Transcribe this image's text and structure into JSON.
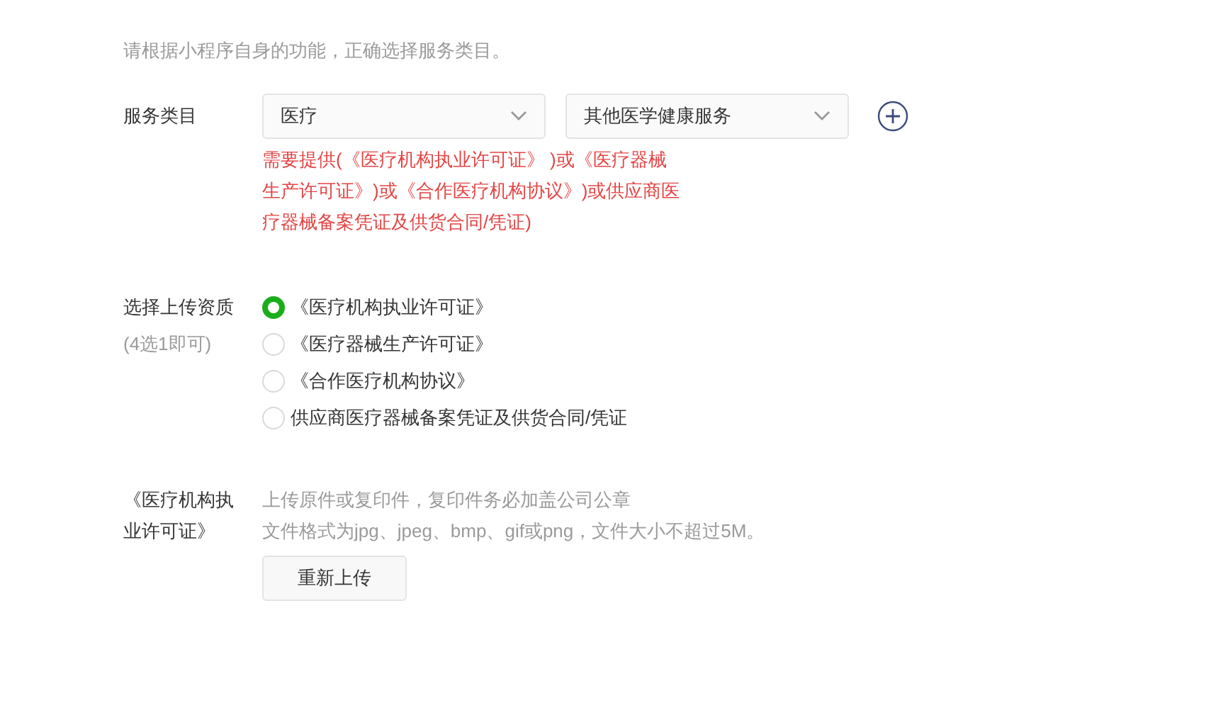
{
  "intro": "请根据小程序自身的功能，正确选择服务类目。",
  "service_category": {
    "label": "服务类目",
    "selects": [
      {
        "value": "医疗"
      },
      {
        "value": "其他医学健康服务"
      }
    ],
    "hint": "需要提供(《医疗机构执业许可证》 )或《医疗器械生产许可证》)或《合作医疗机构协议》)或供应商医疗器械备案凭证及供货合同/凭证)"
  },
  "qualification": {
    "label": "选择上传资质",
    "sublabel": "(4选1即可)",
    "options": [
      {
        "label": "《医疗机构执业许可证》",
        "selected": true
      },
      {
        "label": "《医疗器械生产许可证》",
        "selected": false
      },
      {
        "label": "《合作医疗机构协议》",
        "selected": false
      },
      {
        "label": "供应商医疗器械备案凭证及供货合同/凭证",
        "selected": false
      }
    ]
  },
  "upload": {
    "label": "《医疗机构执业许可证》",
    "notes": [
      "上传原件或复印件，复印件务必加盖公司公章",
      "文件格式为jpg、jpeg、bmp、gif或png，文件大小不超过5M。"
    ],
    "button": "重新上传"
  }
}
